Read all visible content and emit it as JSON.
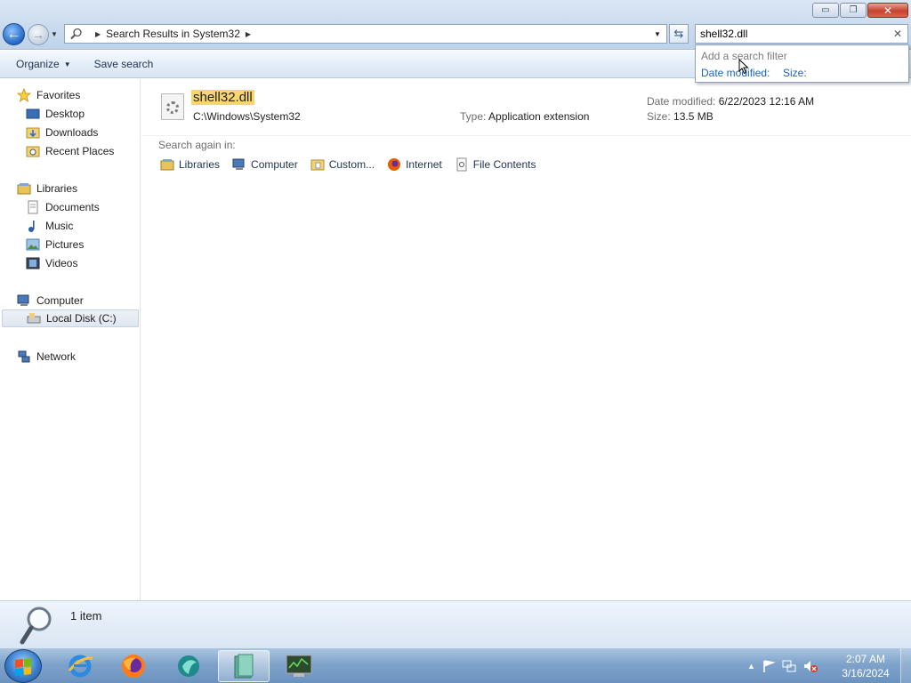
{
  "window": {
    "minimize_glyph": "▭",
    "restore_glyph": "❐",
    "close_glyph": "✕"
  },
  "address": {
    "location": "Search Results in System32"
  },
  "search": {
    "value": "shell32.dll",
    "filter_hint": "Add a search filter",
    "filters": [
      "Date modified:",
      "Size:"
    ]
  },
  "toolbar": {
    "organize": "Organize",
    "save_search": "Save search"
  },
  "sidebar": {
    "favorites": "Favorites",
    "favorites_items": [
      "Desktop",
      "Downloads",
      "Recent Places"
    ],
    "libraries": "Libraries",
    "libraries_items": [
      "Documents",
      "Music",
      "Pictures",
      "Videos"
    ],
    "computer": "Computer",
    "computer_items": [
      "Local Disk (C:)"
    ],
    "network": "Network"
  },
  "result": {
    "name": "shell32.dll",
    "path": "C:\\Windows\\System32",
    "type_label": "Type:",
    "type_value": "Application extension",
    "date_label": "Date modified:",
    "date_value": "6/22/2023 12:16 AM",
    "size_label": "Size:",
    "size_value": "13.5 MB"
  },
  "search_again": {
    "label": "Search again in:",
    "items": [
      "Libraries",
      "Computer",
      "Custom...",
      "Internet",
      "File Contents"
    ]
  },
  "details": {
    "count": "1 item"
  },
  "clock": {
    "time": "2:07 AM",
    "date": "3/16/2024"
  },
  "colors": {
    "highlight": "#f7d66f",
    "link": "#1d62b5",
    "taskbar": "#7fa3cb"
  }
}
